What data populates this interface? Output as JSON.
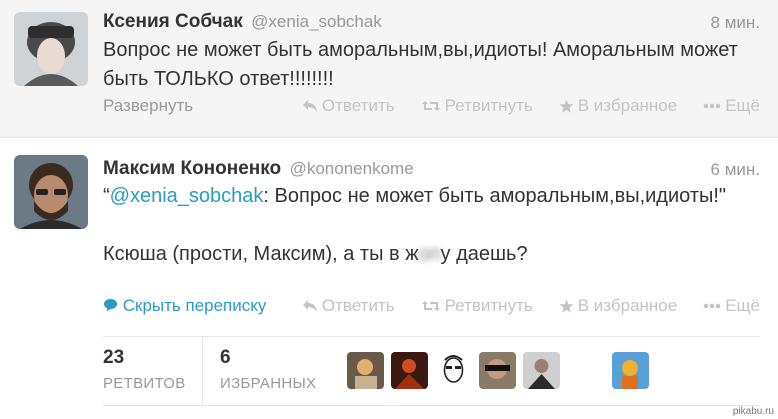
{
  "tweets": [
    {
      "fullname": "Ксения Собчак",
      "username": "@xenia_sobchak",
      "time": "8 мин.",
      "text": "Вопрос не может быть аморальным,вы,идиоты! Аморальным может быть ТОЛЬКО ответ!!!!!!!!",
      "expand_label": "Развернуть"
    },
    {
      "fullname": "Максим Кононенко",
      "username": "@kononenkome",
      "time": "6 мин.",
      "quote_open": "“",
      "mention": "@xenia_sobchak",
      "quote_text": ": Вопрос не может быть аморальным,вы,идиоты!\"",
      "reply_before": "Ксюша (прости, Максим), а ты в ж",
      "reply_blurred": "оп",
      "reply_after": "у даешь?",
      "hide_label": "Скрыть переписку"
    }
  ],
  "actions": {
    "reply": "Ответить",
    "retweet": "Ретвитнуть",
    "favorite": "В избранное",
    "more": "Ещё"
  },
  "stats": {
    "retweets_count": "23",
    "retweets_label": "РЕТВИТОВ",
    "favorites_count": "6",
    "favorites_label": "ИЗБРАННЫХ"
  },
  "watermark": "pikabu.ru",
  "colors": {
    "link": "#2a9cc3",
    "muted": "#999999",
    "action": "#c4c4c4",
    "header_bg": "#f5f5f5"
  }
}
